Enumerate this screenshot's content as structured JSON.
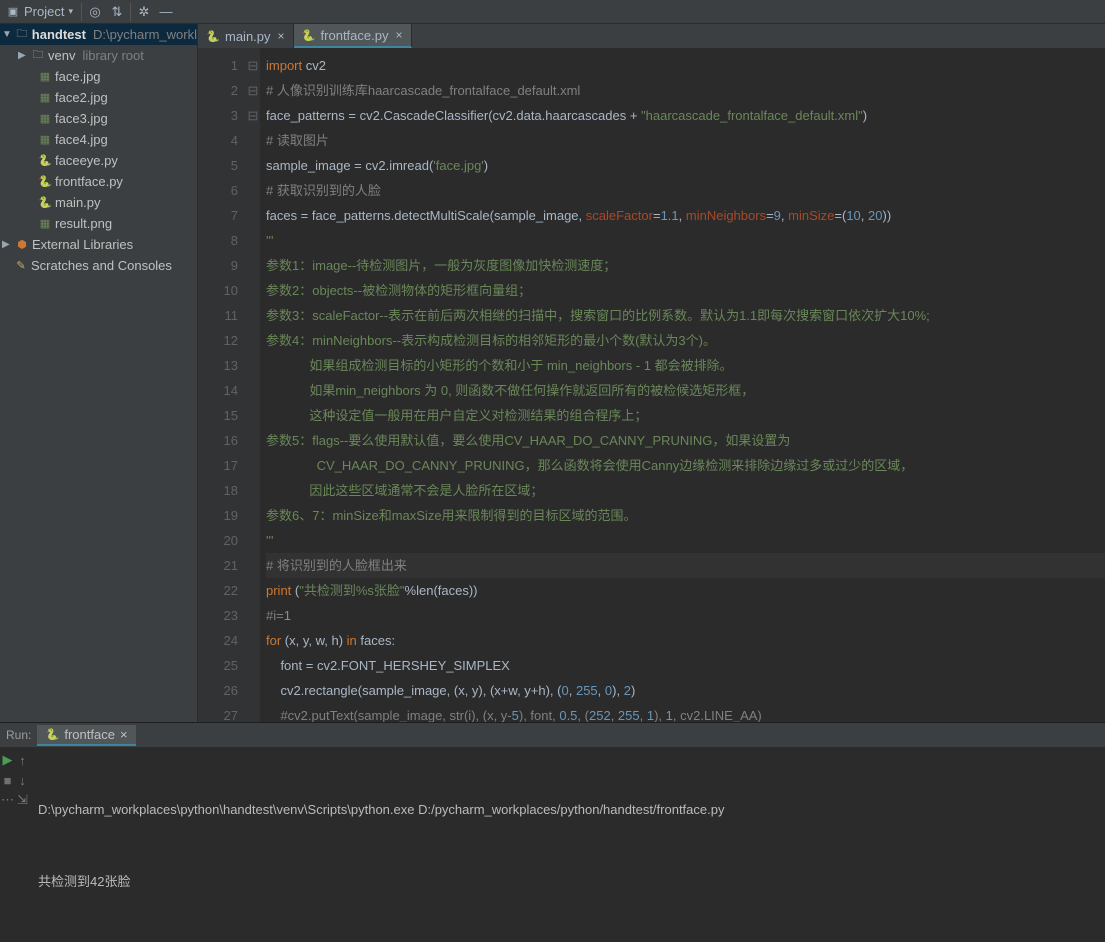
{
  "toolbar": {
    "project_label": "Project"
  },
  "tabs": [
    {
      "name": "main.py",
      "icon": "py"
    },
    {
      "name": "frontface.py",
      "icon": "py",
      "active": true
    }
  ],
  "tree": {
    "root": {
      "label": "handtest",
      "hint": "D:\\pycharm_workl"
    },
    "venv": {
      "label": "venv",
      "hint": "library root"
    },
    "files": [
      {
        "label": "face.jpg",
        "icon": "img"
      },
      {
        "label": "face2.jpg",
        "icon": "img"
      },
      {
        "label": "face3.jpg",
        "icon": "img"
      },
      {
        "label": "face4.jpg",
        "icon": "img"
      },
      {
        "label": "faceeye.py",
        "icon": "py"
      },
      {
        "label": "frontface.py",
        "icon": "py"
      },
      {
        "label": "main.py",
        "icon": "py"
      },
      {
        "label": "result.png",
        "icon": "img"
      }
    ],
    "ext_lib": {
      "label": "External Libraries"
    },
    "scratches": {
      "label": "Scratches and Consoles"
    }
  },
  "code_lines": [
    "import cv2",
    "# 人像识别训练库haarcascade_frontalface_default.xml",
    "face_patterns = cv2.CascadeClassifier(cv2.data.haarcascades + \"haarcascade_frontalface_default.xml\")",
    "# 读取图片",
    "sample_image = cv2.imread('face.jpg')",
    "# 获取识别到的人脸",
    "faces = face_patterns.detectMultiScale(sample_image, scaleFactor=1.1, minNeighbors=9, minSize=(10, 20))",
    "'''",
    "参数1：image--待检测图片，一般为灰度图像加快检测速度；",
    "参数2：objects--被检测物体的矩形框向量组；",
    "参数3：scaleFactor--表示在前后两次相继的扫描中，搜索窗口的比例系数。默认为1.1即每次搜索窗口依次扩大10%;",
    "参数4：minNeighbors--表示构成检测目标的相邻矩形的最小个数(默认为3个)。",
    "            如果组成检测目标的小矩形的个数和小于 min_neighbors - 1 都会被排除。",
    "            如果min_neighbors 为 0, 则函数不做任何操作就返回所有的被检候选矩形框，",
    "            这种设定值一般用在用户自定义对检测结果的组合程序上；",
    "参数5：flags--要么使用默认值，要么使用CV_HAAR_DO_CANNY_PRUNING，如果设置为",
    "              CV_HAAR_DO_CANNY_PRUNING，那么函数将会使用Canny边缘检测来排除边缘过多或过少的区域，",
    "            因此这些区域通常不会是人脸所在区域；",
    "参数6、7：minSize和maxSize用来限制得到的目标区域的范围。",
    "'''",
    "# 将识别到的人脸框出来",
    "print (\"共检测到%s张脸\"%len(faces))",
    "#i=1",
    "for (x, y, w, h) in faces:",
    "    font = cv2.FONT_HERSHEY_SIMPLEX",
    "    cv2.rectangle(sample_image, (x, y), (x+w, y+h), (0, 255, 0), 2)",
    "    #cv2.putText(sample_image, str(i), (x, y-5), font, 0.5, (252, 255, 1), 1, cv2.LINE_AA)"
  ],
  "highlight_line": 21,
  "run": {
    "title": "Run:",
    "tab": "frontface",
    "out1": "D:\\pycharm_workplaces\\python\\handtest\\venv\\Scripts\\python.exe D:/pycharm_workplaces/python/handtest/frontface.py",
    "out2": "共检测到42张脸"
  },
  "colors": {
    "bg": "#2b2b2b",
    "panel": "#3c3f41"
  }
}
